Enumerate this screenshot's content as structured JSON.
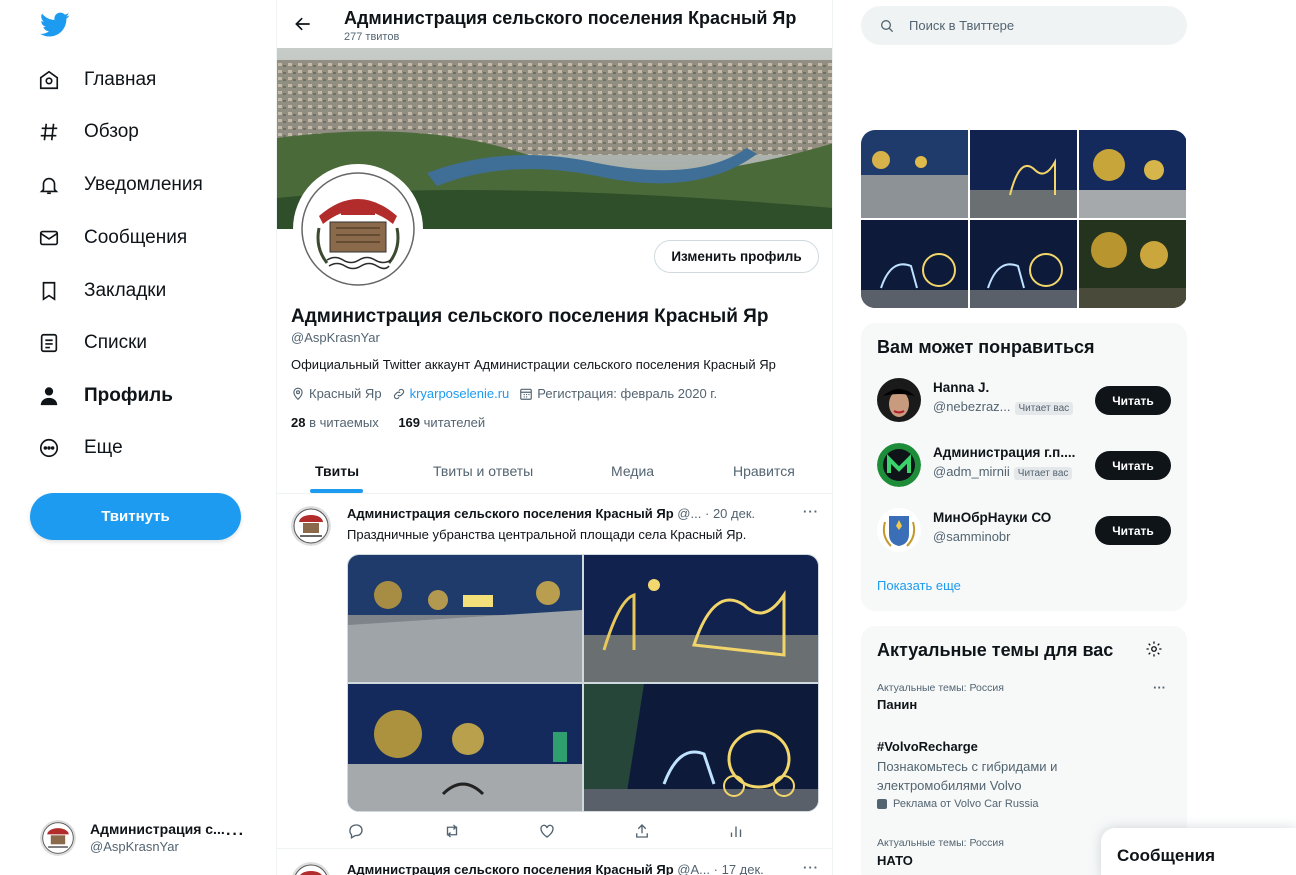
{
  "nav": {
    "items": [
      {
        "label": "Главная",
        "icon": "home-icon"
      },
      {
        "label": "Обзор",
        "icon": "hashtag-icon"
      },
      {
        "label": "Уведомления",
        "icon": "bell-icon"
      },
      {
        "label": "Сообщения",
        "icon": "envelope-icon"
      },
      {
        "label": "Закладки",
        "icon": "bookmark-icon"
      },
      {
        "label": "Списки",
        "icon": "list-icon"
      },
      {
        "label": "Профиль",
        "icon": "person-icon"
      },
      {
        "label": "Еще",
        "icon": "more-circle-icon"
      }
    ],
    "tweet_button": "Твитнуть",
    "account": {
      "name": "Администрация с...",
      "handle": "@AspKrasnYar",
      "more": "···"
    }
  },
  "header": {
    "title": "Администрация сельского поселения Красный Яр",
    "count": "277 твитов"
  },
  "profile": {
    "edit_button": "Изменить профиль",
    "name": "Администрация сельского поселения Красный Яр",
    "handle": "@AspKrasnYar",
    "bio": "Официальный Twitter аккаунт Администрации сельского поселения Красный Яр",
    "location": "Красный Яр",
    "website": "kryarposelenie.ru",
    "joined": "Регистрация: февраль 2020 г.",
    "following_count": "28",
    "following_label": "в читаемых",
    "followers_count": "169",
    "followers_label": "читателей"
  },
  "tabs": [
    "Твиты",
    "Твиты и ответы",
    "Медиа",
    "Нравится"
  ],
  "tweet": {
    "name": "Администрация сельского поселения Красный Яр",
    "handle": "@...",
    "dot": "·",
    "date": "20 дек.",
    "text": "Праздничные убранства центральной площади села Красный Яр.",
    "more": "···"
  },
  "tweet2": {
    "name": "Администрация сельского поселения Красный Яр",
    "handle": "@А...",
    "dot": "·",
    "date": "17 дек.",
    "more": "···"
  },
  "search": {
    "placeholder": "Поиск в Твиттере"
  },
  "who_to_follow": {
    "title": "Вам может понравиться",
    "items": [
      {
        "name": "Hanna J.",
        "handle": "@nebezraz...",
        "badge": "Читает вас",
        "button": "Читать"
      },
      {
        "name": "Администрация г.п....",
        "handle": "@adm_mirnii",
        "badge": "Читает вас",
        "button": "Читать"
      },
      {
        "name": "МинОбрНауки СО",
        "handle": "@samminobr",
        "badge": "",
        "button": "Читать"
      }
    ],
    "show_more": "Показать еще"
  },
  "trends": {
    "title": "Актуальные темы для вас",
    "items": [
      {
        "context": "Актуальные темы: Россия",
        "name": "Панин"
      },
      {
        "name": "#VolvoRecharge",
        "desc": "Познакомьтесь с гибридами и электромобилями Volvo",
        "ad": "Реклама от Volvo Car Russia"
      },
      {
        "context": "Актуальные темы: Россия",
        "name": "НАТО"
      }
    ],
    "more": "···"
  },
  "messages_drawer": {
    "title": "Сообщения"
  },
  "colors": {
    "accent": "#1d9bf0",
    "text": "#0f1419",
    "secondary": "#536471",
    "panel": "#f7f9f9"
  }
}
